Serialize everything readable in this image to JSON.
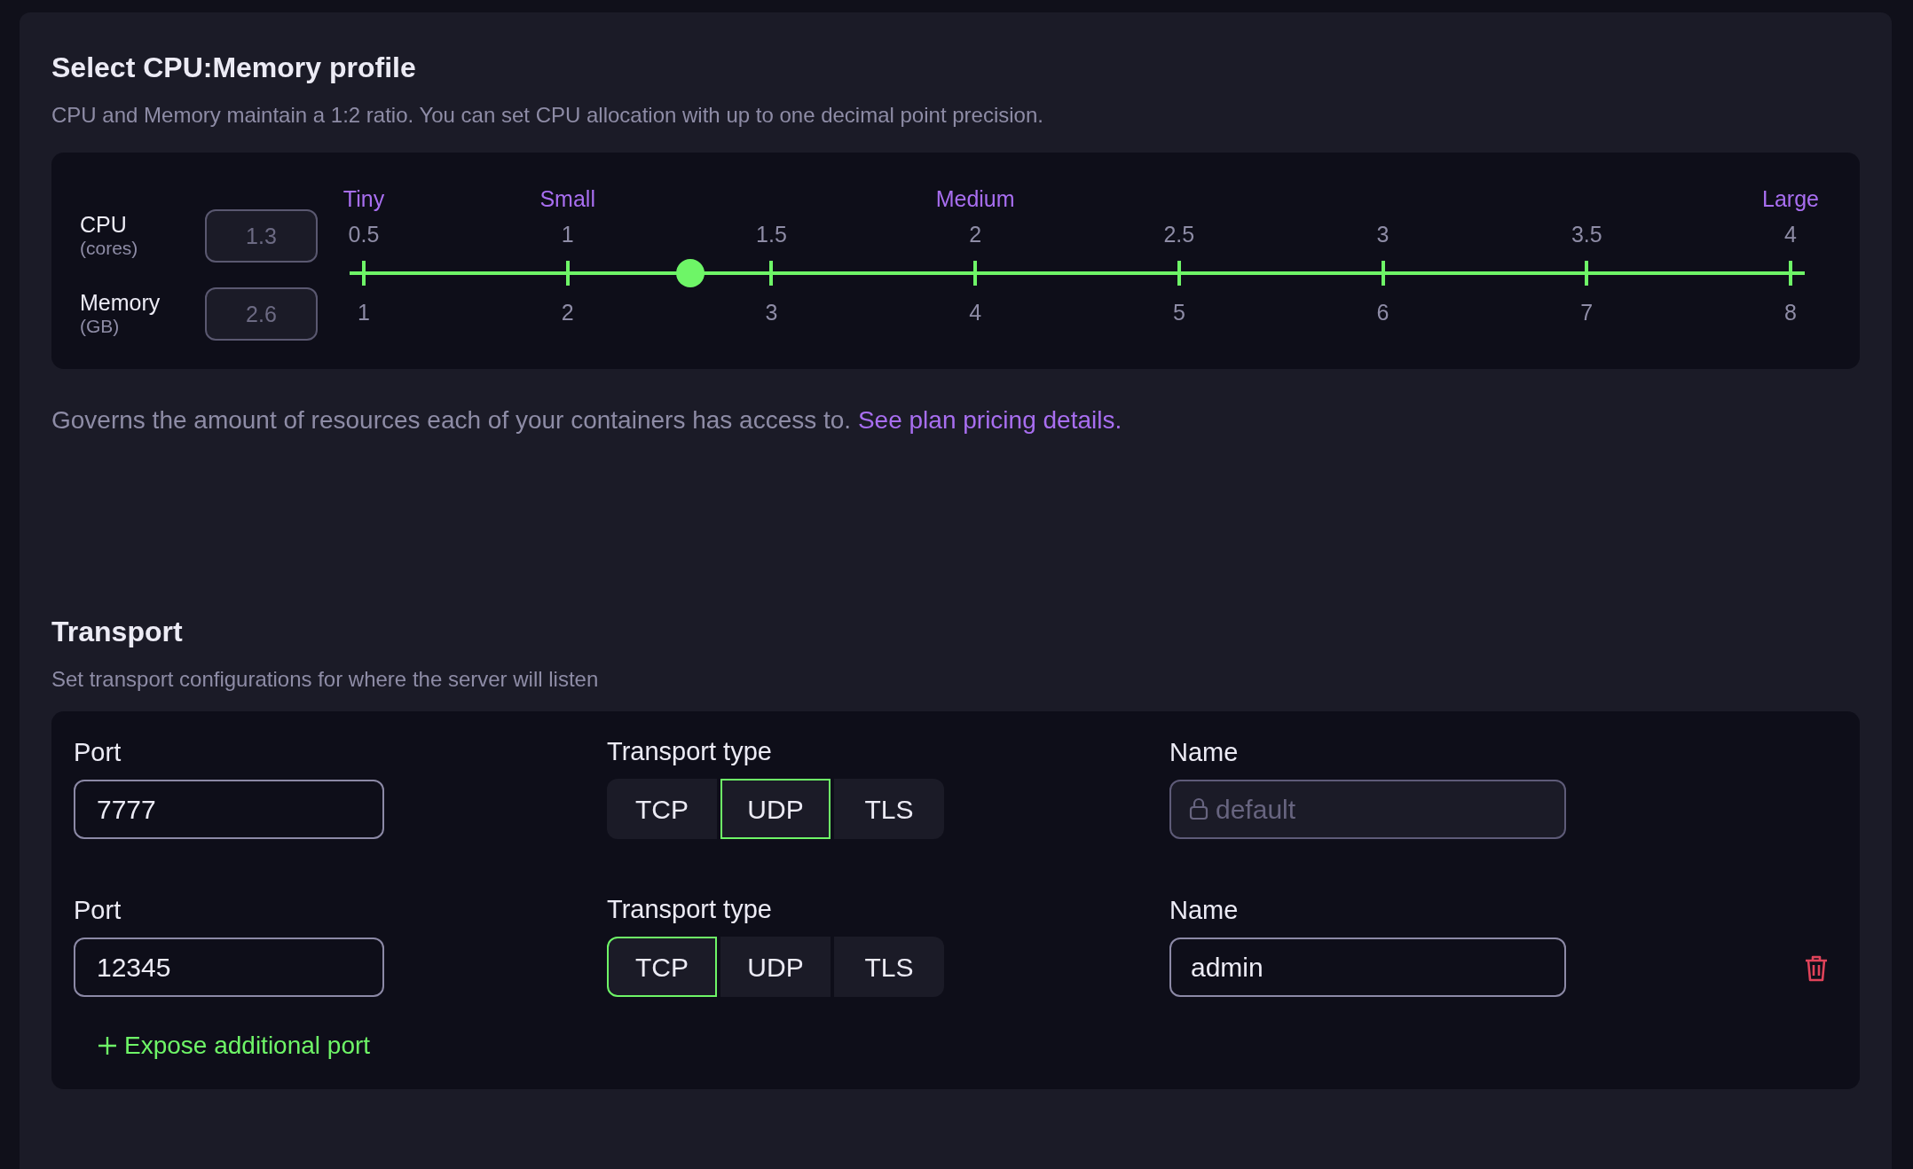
{
  "profile": {
    "title": "Select CPU:Memory profile",
    "description": "CPU and Memory maintain a 1:2 ratio. You can set CPU allocation with up to one decimal point precision.",
    "fields": [
      {
        "label": "CPU",
        "unit": "(cores)",
        "value": "1.3"
      },
      {
        "label": "Memory",
        "unit": "(GB)",
        "value": "2.6"
      }
    ],
    "slider": {
      "level": 0.229,
      "ticks": [
        {
          "cpu": "0.5",
          "memory": "1",
          "profile": "Tiny"
        },
        {
          "cpu": "1",
          "memory": "2",
          "profile": "Small"
        },
        {
          "cpu": "1.5",
          "memory": "3"
        },
        {
          "cpu": "2",
          "memory": "4",
          "profile": "Medium"
        },
        {
          "cpu": "2.5",
          "memory": "5"
        },
        {
          "cpu": "3",
          "memory": "6"
        },
        {
          "cpu": "3.5",
          "memory": "7"
        },
        {
          "cpu": "4",
          "memory": "8",
          "profile": "Large"
        }
      ]
    },
    "note": {
      "text": "Governs the amount of resources each of your containers has access to.",
      "link": "See plan pricing details."
    }
  },
  "transport": {
    "title": "Transport",
    "description": "Set transport configurations for where the server will listen",
    "rows": [
      {
        "port_label": "Port",
        "port": "7777",
        "type_label": "Transport type",
        "types": [
          {
            "label": "TCP",
            "selected": false
          },
          {
            "label": "UDP",
            "selected": true
          },
          {
            "label": "TLS",
            "selected": false
          }
        ],
        "name_label": "Name",
        "name": "default",
        "locked": true,
        "removable": false
      },
      {
        "port_label": "Port",
        "port": "12345",
        "type_label": "Transport type",
        "types": [
          {
            "label": "TCP",
            "selected": true
          },
          {
            "label": "UDP",
            "selected": false
          },
          {
            "label": "TLS",
            "selected": false
          }
        ],
        "name_label": "Name",
        "name": "admin",
        "locked": false,
        "removable": true
      }
    ],
    "add_button": "Expose additional port"
  }
}
